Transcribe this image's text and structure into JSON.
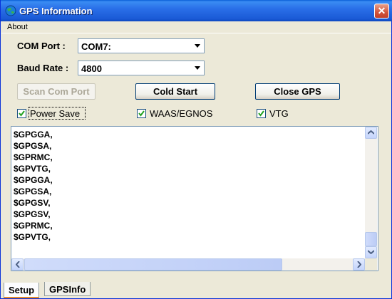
{
  "window": {
    "title": "GPS Information",
    "close_glyph": "✕"
  },
  "menu": {
    "about": "About"
  },
  "form": {
    "com_port_label": "COM Port :",
    "com_port_value": "COM7:",
    "baud_rate_label": "Baud Rate :",
    "baud_rate_value": "4800"
  },
  "buttons": {
    "scan": "Scan Com Port",
    "cold_start": "Cold Start",
    "close_gps": "Close GPS"
  },
  "checkboxes": {
    "power_save": {
      "label": "Power Save",
      "checked": true
    },
    "waas": {
      "label": "WAAS/EGNOS",
      "checked": true
    },
    "vtg": {
      "label": "VTG",
      "checked": true
    }
  },
  "log": {
    "lines": [
      "$GPGGA,",
      "$GPGSA,",
      "$GPRMC,",
      "$GPVTG,",
      "$GPGGA,",
      "$GPGSA,",
      "$GPGSV,",
      "$GPGSV,",
      "$GPRMC,",
      "$GPVTG,"
    ]
  },
  "tabs": [
    {
      "label": "Setup",
      "active": true
    },
    {
      "label": "GPSInfo",
      "active": false
    }
  ],
  "icons": {
    "app": "globe-icon",
    "dropdown": "chevron-down-icon",
    "check": "checkmark-icon"
  },
  "colors": {
    "titlebar": "#0a5fd8",
    "close": "#d2533a",
    "tab_highlight": "#e68b2c"
  }
}
